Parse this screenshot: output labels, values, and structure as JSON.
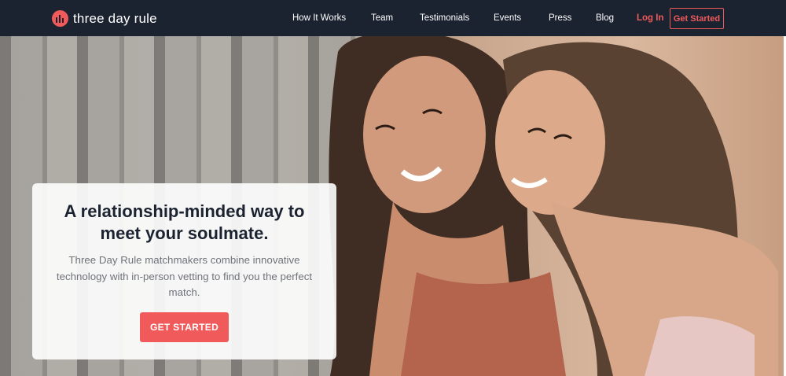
{
  "brand": {
    "name": "three day rule",
    "accent": "#f05a5b",
    "nav_bg": "#1b2230"
  },
  "nav": {
    "items": [
      {
        "label": "How It Works"
      },
      {
        "label": "Team"
      },
      {
        "label": "Testimonials"
      },
      {
        "label": "Events"
      },
      {
        "label": "Press"
      },
      {
        "label": "Blog"
      }
    ],
    "login_label": "Log In",
    "cta_label": "Get Started"
  },
  "hero": {
    "headline": "A relationship-minded way to meet your soulmate.",
    "body": "Three Day Rule matchmakers combine innovative technology with in-person vetting to find you the perfect match.",
    "button_label": "GET STARTED"
  }
}
